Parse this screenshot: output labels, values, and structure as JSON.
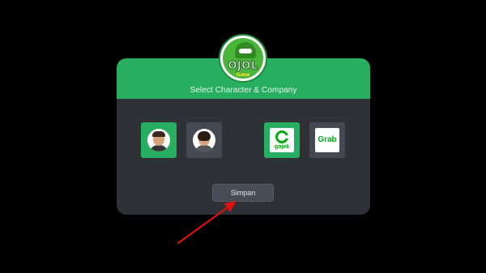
{
  "dialog": {
    "title": "Select Character & Company"
  },
  "logo": {
    "title": "OJOL",
    "subtitle": "Game"
  },
  "characters": [
    {
      "name": "Character 1",
      "selected": true
    },
    {
      "name": "Character 2",
      "selected": false
    }
  ],
  "companies": [
    {
      "label": "gojek",
      "selected": true
    },
    {
      "label": "Grab",
      "selected": false
    }
  ],
  "actions": {
    "save_label": "Simpan"
  },
  "colors": {
    "accent": "#27ae60",
    "dialog_bg": "#2e3136",
    "card_bg": "#454a52",
    "arrow": "#e01010"
  }
}
